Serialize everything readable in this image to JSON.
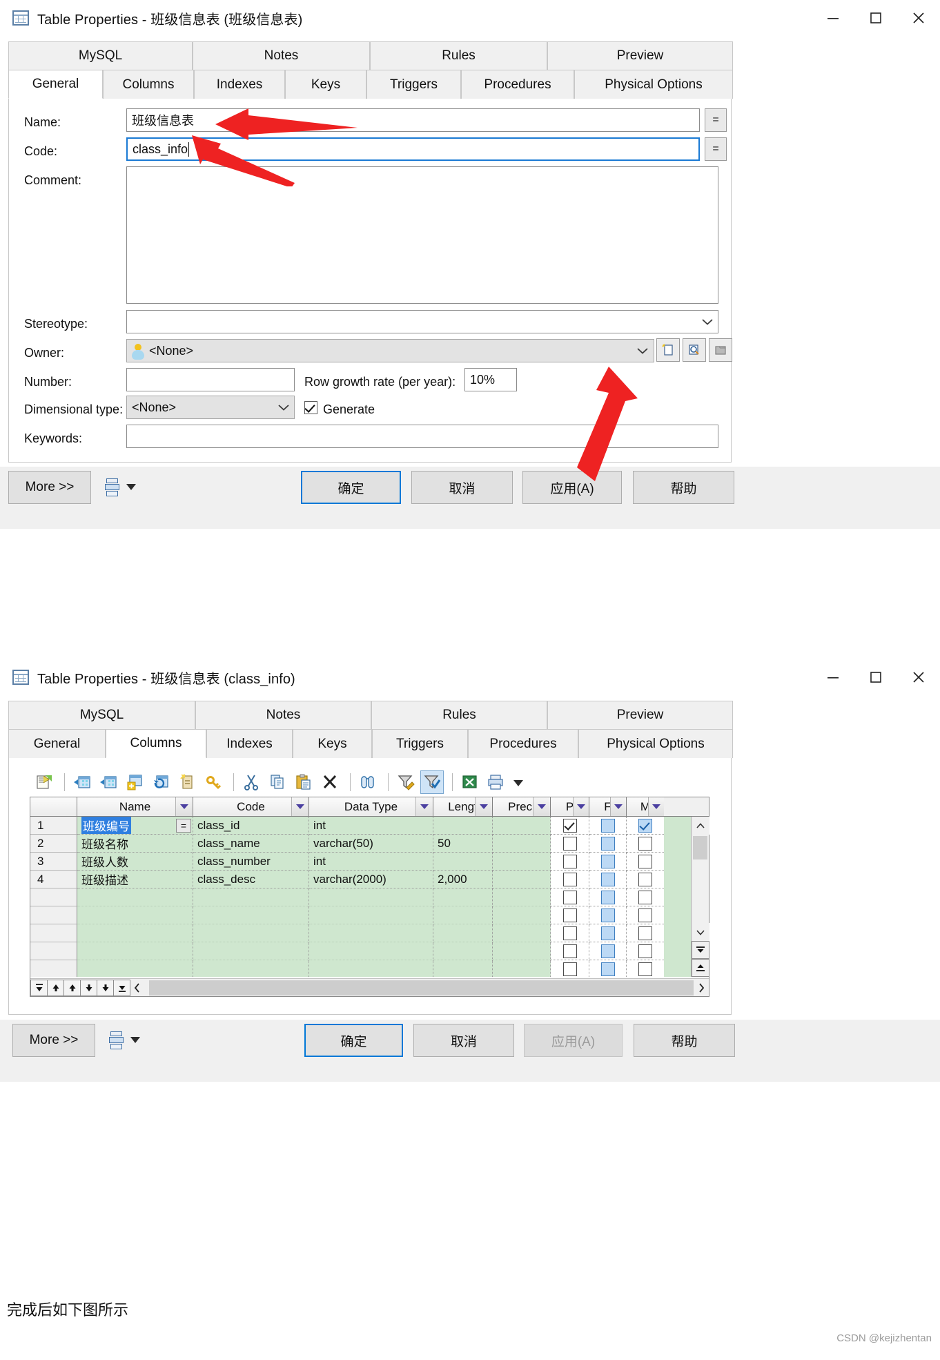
{
  "dialog1": {
    "title": "Table Properties - 班级信息表 (班级信息表)",
    "window_icon": "table-icon",
    "controls": {
      "minimize": "minimize-icon",
      "maximize": "maximize-icon",
      "close": "close-icon"
    },
    "tabs_top": [
      "MySQL",
      "Notes",
      "Rules",
      "Preview"
    ],
    "tabs_bottom": [
      "General",
      "Columns",
      "Indexes",
      "Keys",
      "Triggers",
      "Procedures",
      "Physical Options"
    ],
    "active_tab": "General",
    "fields": {
      "name_label": "Name:",
      "name_value": "班级信息表",
      "name_ellipsis": "=",
      "code_label": "Code:",
      "code_value": "class_info",
      "code_ellipsis": "=",
      "comment_label": "Comment:",
      "comment_value": "",
      "stereotype_label": "Stereotype:",
      "stereotype_value": "",
      "owner_label": "Owner:",
      "owner_value": "<None>",
      "owner_icon": "person-icon",
      "owner_buttons": [
        "new-object-icon",
        "properties-icon",
        "select-object-icon"
      ],
      "number_label": "Number:",
      "number_value": "",
      "growth_label": "Row growth rate (per year):",
      "growth_value": "10%",
      "dimensional_label": "Dimensional type:",
      "dimensional_value": "<None>",
      "generate_label": "Generate",
      "generate_checked": true,
      "keywords_label": "Keywords:",
      "keywords_value": ""
    },
    "footer": {
      "more": "More >>",
      "print_icon": "print-preview-icon",
      "dropdown_icon": "chevron-down-icon",
      "ok": "确定",
      "cancel": "取消",
      "apply": "应用(A)",
      "help": "帮助",
      "apply_disabled": false
    }
  },
  "dialog2": {
    "title": "Table Properties - 班级信息表 (class_info)",
    "window_icon": "table-icon",
    "controls": {
      "minimize": "minimize-icon",
      "maximize": "maximize-icon",
      "close": "close-icon"
    },
    "tabs_top": [
      "MySQL",
      "Notes",
      "Rules",
      "Preview"
    ],
    "tabs_bottom": [
      "General",
      "Columns",
      "Indexes",
      "Keys",
      "Triggers",
      "Procedures",
      "Physical Options"
    ],
    "active_tab": "Columns",
    "toolbar": [
      "insert-column-icon",
      "add-row-icon",
      "insert-row-icon",
      "add-table-icon",
      "refresh-table-icon",
      "new-note-icon",
      "new-key-icon",
      "cut-icon",
      "copy-icon",
      "paste-icon",
      "delete-icon",
      "find-icon",
      "customize-filter-icon",
      "apply-filter-icon",
      "export-excel-icon",
      "print-icon",
      "print-dropdown-icon"
    ],
    "grid": {
      "headers": [
        "",
        "Name",
        "Code",
        "Data Type",
        "Lengt",
        "Preci",
        "P",
        "F",
        "M"
      ],
      "rows": [
        {
          "index": "1",
          "name": "班级编号",
          "code": "class_id",
          "type": "int",
          "length": "",
          "precision": "",
          "p": true,
          "f": "blue",
          "m": true,
          "selected": true,
          "ellipsis": "="
        },
        {
          "index": "2",
          "name": "班级名称",
          "code": "class_name",
          "type": "varchar(50)",
          "length": "50",
          "precision": "",
          "p": false,
          "f": "blue",
          "m": false,
          "selected": false,
          "ellipsis": ""
        },
        {
          "index": "3",
          "name": "班级人数",
          "code": "class_number",
          "type": "int",
          "length": "",
          "precision": "",
          "p": false,
          "f": "blue",
          "m": false,
          "selected": false,
          "ellipsis": ""
        },
        {
          "index": "4",
          "name": "班级描述",
          "code": "class_desc",
          "type": "varchar(2000)",
          "length": "2,000",
          "precision": "",
          "p": false,
          "f": "blue",
          "m": false,
          "selected": false,
          "ellipsis": ""
        }
      ],
      "empty_rows": 12,
      "nav_buttons": [
        "first-icon",
        "top-icon",
        "up-icon",
        "down-icon",
        "bottom-icon",
        "last-icon",
        "collapse-icon"
      ]
    },
    "footer": {
      "more": "More >>",
      "print_icon": "print-preview-icon",
      "dropdown_icon": "chevron-down-icon",
      "ok": "确定",
      "cancel": "取消",
      "apply": "应用(A)",
      "help": "帮助",
      "apply_disabled": true
    }
  },
  "page": {
    "footnote": "完成后如下图所示",
    "watermark": "CSDN @kejizhentan"
  },
  "colors": {
    "accent": "#0078d7",
    "grid_row": "#cfe7cf",
    "selection": "#2f7fe0",
    "annotation_arrow": "#ee2222"
  }
}
